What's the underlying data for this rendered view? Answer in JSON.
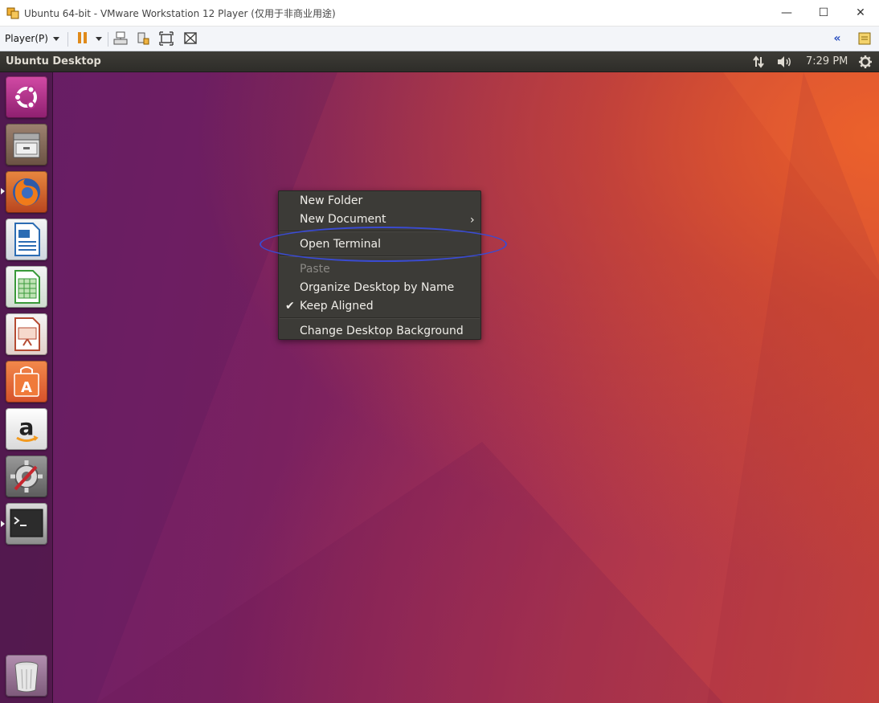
{
  "window": {
    "title": "Ubuntu 64-bit - VMware Workstation 12 Player (仅用于非商业用途)",
    "controls": {
      "minimize": "—",
      "maximize": "☐",
      "close": "✕"
    }
  },
  "toolbar": {
    "player_menu": "Player(P)",
    "icons": [
      "pause-icon",
      "dropdown-icon",
      "send-ctrl-alt-del-icon",
      "removable-devices-icon",
      "fullscreen-icon",
      "unity-icon",
      "collapse-icon",
      "message-log-icon"
    ]
  },
  "panel": {
    "title": "Ubuntu Desktop",
    "time": "7:29 PM",
    "indicators": [
      "network-icon",
      "volume-icon",
      "settings-gear-icon"
    ]
  },
  "launcher": {
    "items": [
      {
        "name": "dash",
        "icon": "ubuntu-logo-icon",
        "color": "#b7348f"
      },
      {
        "name": "files",
        "icon": "file-cabinet-icon",
        "color": "#8a6d56"
      },
      {
        "name": "firefox",
        "icon": "firefox-icon",
        "color": "#d8572a",
        "running": true
      },
      {
        "name": "libreoffice-writer",
        "icon": "writer-icon",
        "color": "#2b6cb3"
      },
      {
        "name": "libreoffice-calc",
        "icon": "calc-icon",
        "color": "#3a9a3a"
      },
      {
        "name": "libreoffice-impress",
        "icon": "impress-icon",
        "color": "#b54b33"
      },
      {
        "name": "ubuntu-software",
        "icon": "software-bag-icon",
        "color": "#e4622a"
      },
      {
        "name": "amazon",
        "icon": "amazon-icon",
        "color": "#eeeeee"
      },
      {
        "name": "system-settings",
        "icon": "settings-wrench-icon",
        "color": "#7b1e42"
      },
      {
        "name": "terminal",
        "icon": "terminal-icon",
        "color": "#4a4a4a",
        "running": true
      },
      {
        "name": "trash",
        "icon": "trash-icon",
        "color": "#9a7292"
      }
    ]
  },
  "context_menu": {
    "items": [
      {
        "label": "New Folder",
        "enabled": true
      },
      {
        "label": "New Document",
        "enabled": true,
        "submenu": true
      },
      {
        "label": "Open Terminal",
        "enabled": true,
        "highlighted_by_annotation": true
      },
      {
        "label": "Paste",
        "enabled": false
      },
      {
        "label": "Organize Desktop by Name",
        "enabled": true
      },
      {
        "label": "Keep Aligned",
        "enabled": true,
        "checked": true
      },
      {
        "label": "Change Desktop Background",
        "enabled": true
      }
    ],
    "submenu_arrow": "›",
    "check_mark": "✔"
  },
  "colors": {
    "panel_bg": "#3c3b37",
    "menu_bg": "#3c3b37",
    "annotation_ellipse": "#3a4bd1",
    "desktop_purple": "#6b1f69",
    "desktop_orange": "#d8572a"
  }
}
